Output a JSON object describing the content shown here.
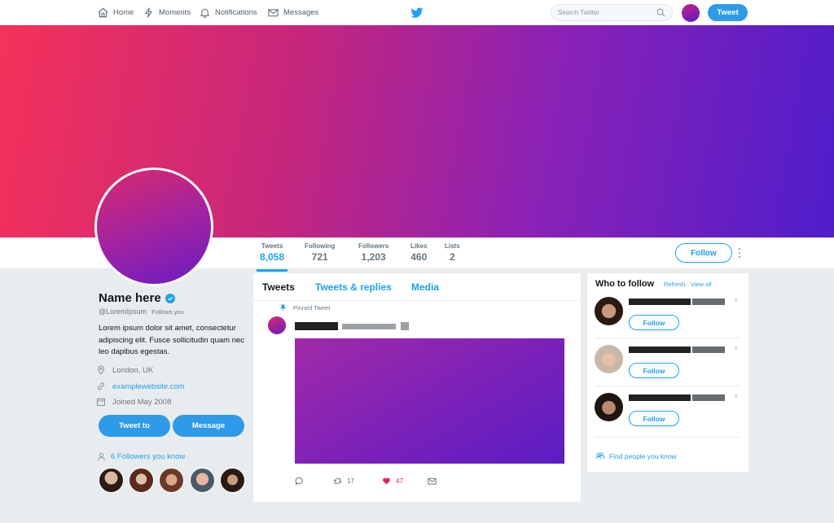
{
  "nav": {
    "items": [
      {
        "label": "Home",
        "icon": "home-icon"
      },
      {
        "label": "Moments",
        "icon": "lightning-icon"
      },
      {
        "label": "Notifications",
        "icon": "bell-icon"
      },
      {
        "label": "Messages",
        "icon": "envelope-icon"
      }
    ],
    "search_placeholder": "Search Twitter",
    "tweet_button": "Tweet"
  },
  "profile": {
    "name": "Name here",
    "handle": "@LoremIpsum",
    "follows_you": "Follows you",
    "bio": "Lorem ipsum dolor sit amet, consectetur adipiscing elit. Fusce sollicitudin quam nec leo dapibus egestas.",
    "location": "London, UK",
    "website": "examplewebsite.com",
    "joined": "Joined May 2008",
    "tweet_to_button": "Tweet to",
    "message_button": "Message",
    "followers_you_know": "6 Followers you know"
  },
  "stats": [
    {
      "label": "Tweets",
      "value": "8,058",
      "active": true
    },
    {
      "label": "Following",
      "value": "721"
    },
    {
      "label": "Followers",
      "value": "1,203"
    },
    {
      "label": "Likes",
      "value": "460"
    },
    {
      "label": "Lists",
      "value": "2"
    }
  ],
  "follow_button": "Follow",
  "timeline": {
    "tabs": [
      "Tweets",
      "Tweets & replies",
      "Media"
    ],
    "pinned_label": "Pinned Tweet",
    "retweets": "17",
    "likes": "47"
  },
  "who_to_follow": {
    "title": "Who to follow",
    "refresh": "Refresh",
    "separator": "·",
    "view_all": "View all",
    "follow_label": "Follow",
    "dismiss": "×",
    "find_people": "Find people you know"
  },
  "colors": {
    "accent": "#1da1f2",
    "button_blue": "#2d9be8",
    "banner_start": "#f5325a",
    "banner_end": "#4f1dcb",
    "like_red": "#e0245e"
  }
}
